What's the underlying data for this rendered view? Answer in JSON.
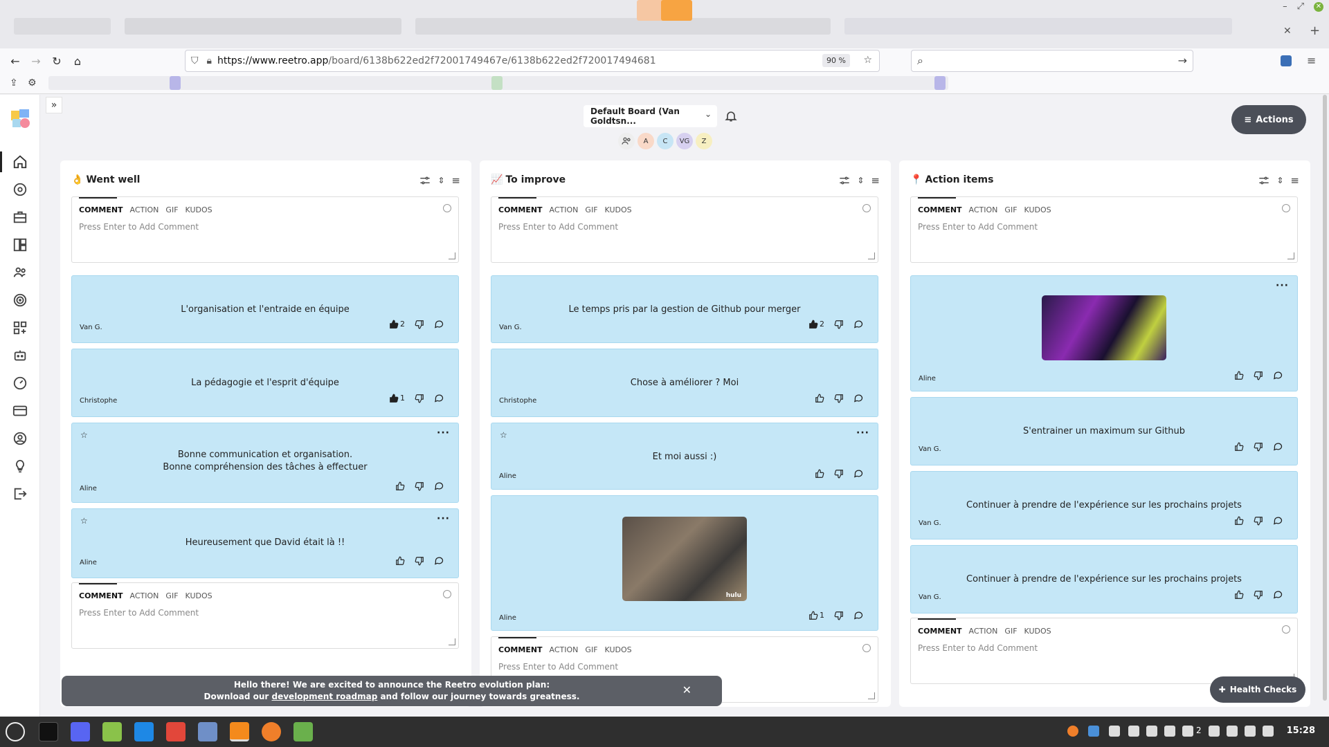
{
  "browser": {
    "url_host": "https://www.reetro.app",
    "url_path": "/board/6138b622ed2f72001749467e/6138b622ed2f720017494681",
    "zoom": "90 %"
  },
  "board": {
    "name": "Default Board (Van Goldtsn...",
    "actions_label": "Actions",
    "members": [
      {
        "initial": "A",
        "color": "#f9d9c8"
      },
      {
        "initial": "C",
        "color": "#c7e5f5"
      },
      {
        "initial": "VG",
        "color": "#d7d0f0"
      },
      {
        "initial": "Z",
        "color": "#f7efc1"
      }
    ]
  },
  "composer": {
    "tabs": [
      "COMMENT",
      "ACTION",
      "GIF",
      "KUDOS"
    ],
    "placeholder": "Press Enter to Add Comment"
  },
  "columns": [
    {
      "title": "Went well",
      "emoji": "👌",
      "cards": [
        {
          "text": "L'organisation et l'entraide en équipe",
          "author": "Van G.",
          "likes": "2",
          "liked": true
        },
        {
          "text": "La pédagogie et l'esprit d'équipe",
          "author": "Christophe",
          "likes": "1",
          "liked": true
        },
        {
          "text": "Bonne communication et organisation.",
          "text2": "Bonne compréhension des tâches à effectuer",
          "author": "Aline",
          "likes": "",
          "liked": false
        },
        {
          "text": "Heureusement que David était là !!",
          "author": "Aline",
          "likes": "",
          "liked": false
        }
      ]
    },
    {
      "title": "To improve",
      "emoji": "📈",
      "cards": [
        {
          "text": "Le temps pris par la gestion de Github pour merger",
          "author": "Van G.",
          "likes": "2",
          "liked": true
        },
        {
          "text": "Chose à améliorer ? Moi",
          "author": "Christophe",
          "likes": "",
          "liked": false
        },
        {
          "text": "Et moi aussi :)",
          "author": "Aline",
          "likes": "",
          "liked": false
        },
        {
          "text": "",
          "author": "Aline",
          "likes": "1",
          "liked": false,
          "gif_label": "hulu"
        }
      ]
    },
    {
      "title": "Action items",
      "emoji": "📍",
      "cards": [
        {
          "text": "",
          "author": "Aline",
          "likes": "",
          "liked": false
        },
        {
          "text": "S'entrainer un maximum sur Github",
          "author": "Van G.",
          "likes": "",
          "liked": false
        },
        {
          "text": "Continuer à prendre de l'expérience sur les prochains projets",
          "author": "Van G.",
          "likes": "",
          "liked": false
        },
        {
          "text": "Continuer à prendre de l'expérience sur les prochains projets",
          "author": "Van G.",
          "likes": "",
          "liked": false
        }
      ]
    }
  ],
  "banner": {
    "line1": "Hello there! We are excited to announce the Reetro evolution plan:",
    "line2_pre": "Download our ",
    "line2_link": "development roadmap",
    "line2_post": " and follow our journey towards greatness."
  },
  "health_checks_label": "Health Checks",
  "taskbar": {
    "clock": "15:28",
    "notif_count": "2"
  }
}
